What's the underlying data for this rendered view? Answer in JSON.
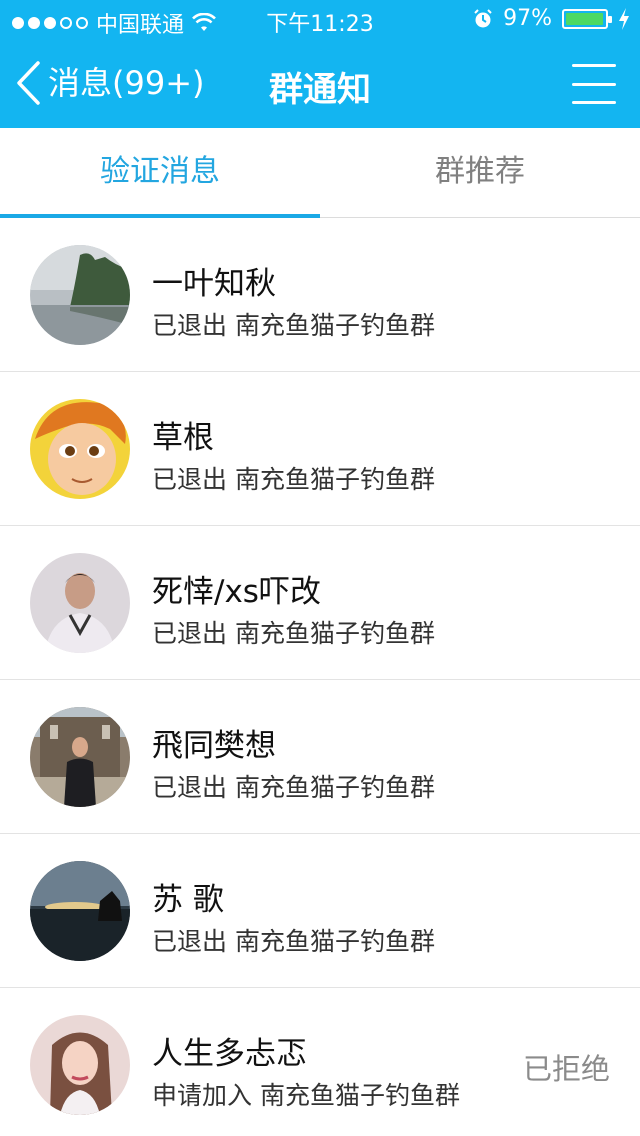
{
  "statusbar": {
    "carrier": "中国联通",
    "time": "下午11:23",
    "battery": "97%",
    "signal_filled": 3,
    "signal_total": 5,
    "battery_level": 0.97
  },
  "nav": {
    "back_label": "消息(99+)",
    "title": "群通知"
  },
  "tabs": [
    {
      "label": "验证消息",
      "active": true
    },
    {
      "label": "群推荐",
      "active": false
    }
  ],
  "items": [
    {
      "name": "一叶知秋",
      "action": "已退出 南充鱼猫子钓鱼群",
      "status": "",
      "avatar": "lake-photo"
    },
    {
      "name": "草根",
      "action": "已退出 南充鱼猫子钓鱼群",
      "status": "",
      "avatar": "cartoon-face"
    },
    {
      "name": "死悻/xs吓改",
      "action": "已退出 南充鱼猫子钓鱼群",
      "status": "",
      "avatar": "man-portrait"
    },
    {
      "name": "飛同樊想",
      "action": "已退出 南充鱼猫子钓鱼群",
      "status": "",
      "avatar": "man-in-suit"
    },
    {
      "name": "苏 歌",
      "action": "已退出 南充鱼猫子钓鱼群",
      "status": "",
      "avatar": "sunset-photo"
    },
    {
      "name": "人生多忐忑",
      "action": "申请加入 南充鱼猫子钓鱼群",
      "status": "已拒绝",
      "avatar": "woman-portrait"
    }
  ],
  "colors": {
    "header": "#13b5f1",
    "tab_active": "#23a6e0",
    "battery_fill": "#4cd964"
  }
}
